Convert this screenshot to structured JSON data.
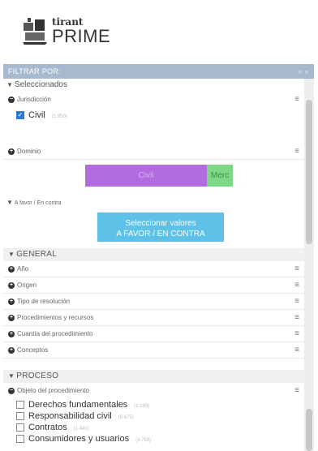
{
  "logo": {
    "small": "tirant",
    "big": "PRIME"
  },
  "filter_bar": {
    "title": "FILTRAR POR:",
    "controls": "«  »"
  },
  "selected": {
    "heading": "Seleccionados",
    "jurisdiccion": {
      "label": "Jurisdicción",
      "item": "Civil",
      "count": "(1.950)"
    },
    "dominio": {
      "label": "Dominio",
      "bar_purple": "Civil",
      "bar_green": "Merc"
    },
    "afavor": {
      "label": "A favor / En contra",
      "button_line1": "Seleccionar valores",
      "button_line2": "A FAVOR / EN CONTRA"
    }
  },
  "general": {
    "heading": "GENERAL",
    "rows": [
      "Año",
      "Origen",
      "Tipo de resolución",
      "Procedimientos y recursos",
      "Cuantía del procedimiento",
      "Conceptos"
    ]
  },
  "proceso": {
    "heading": "PROCESO",
    "objeto": "Objeto del procedimiento",
    "items": [
      {
        "label": "Derechos fundamentales",
        "count": "(1.189)"
      },
      {
        "label": "Responsabilidad civil",
        "count": "(5.675)"
      },
      {
        "label": "Contratos",
        "count": "(1.440)"
      },
      {
        "label": "Consumidores y usuarios",
        "count": "(4.759)"
      }
    ]
  }
}
